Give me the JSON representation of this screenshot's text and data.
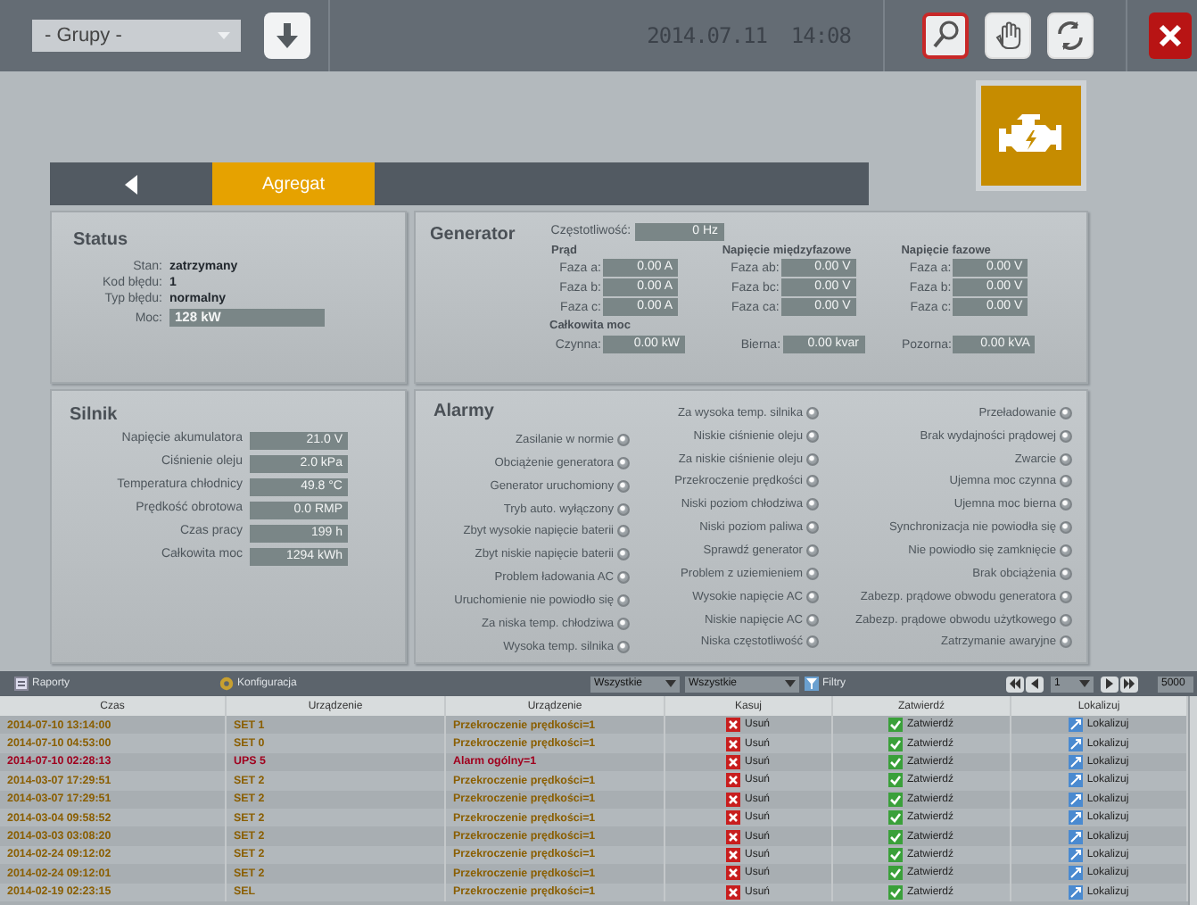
{
  "top_bar": {
    "group_select": {
      "value": "- Grupy -"
    },
    "datetime": "2014.07.11  14:08",
    "tools": [
      {
        "kind": "search",
        "selected": true
      },
      {
        "kind": "hand",
        "selected": false
      },
      {
        "kind": "refresh",
        "selected": false
      }
    ]
  },
  "nav": {
    "tabs": [
      {
        "label": "Agregat",
        "selected": true
      }
    ]
  },
  "status": {
    "title": "Status",
    "fields": [
      {
        "label": "Stan:",
        "value": "zatrzymany",
        "kind": "text"
      },
      {
        "label": "Kod błędu:",
        "value": "1",
        "kind": "text"
      },
      {
        "label": "Typ błędu:",
        "value": "normalny",
        "kind": "text"
      },
      {
        "label": "Moc:",
        "value": "128 kW",
        "kind": "box"
      }
    ]
  },
  "generator": {
    "title": "Generator",
    "frequency": {
      "label": "Częstotliwość:",
      "value": "0 Hz"
    },
    "groups": [
      {
        "title": "Prąd",
        "rows": [
          {
            "label": "Faza a:",
            "value": "0.00 A"
          },
          {
            "label": "Faza b:",
            "value": "0.00 A"
          },
          {
            "label": "Faza c:",
            "value": "0.00 A"
          }
        ]
      },
      {
        "title": "Napięcie międzyfazowe",
        "rows": [
          {
            "label": "Faza ab:",
            "value": "0.00 V"
          },
          {
            "label": "Faza bc:",
            "value": "0.00 V"
          },
          {
            "label": "Faza ca:",
            "value": "0.00 V"
          }
        ]
      },
      {
        "title": "Napięcie fazowe",
        "rows": [
          {
            "label": "Faza a:",
            "value": "0.00 V"
          },
          {
            "label": "Faza b:",
            "value": "0.00 V"
          },
          {
            "label": "Faza c:",
            "value": "0.00 V"
          }
        ]
      }
    ],
    "power_title": "Całkowita moc",
    "power": [
      {
        "label": "Czynna:",
        "value": "0.00 kW"
      },
      {
        "label": "Bierna:",
        "value": "0.00 kvar"
      },
      {
        "label": "Pozorna:",
        "value": "0.00 kVA"
      }
    ]
  },
  "silnik": {
    "title": "Silnik",
    "rows": [
      {
        "label": "Napięcie akumulatora",
        "value": "21.0 V"
      },
      {
        "label": "Ciśnienie oleju",
        "value": "2.0 kPa"
      },
      {
        "label": "Temperatura chłodnicy",
        "value": "49.8 °C"
      },
      {
        "label": "Prędkość obrotowa",
        "value": "0.0 RMP"
      },
      {
        "label": "Czas pracy",
        "value": "199 h"
      },
      {
        "label": "Całkowita moc",
        "value": "1294 kWh"
      }
    ]
  },
  "alarmy": {
    "title": "Alarmy",
    "columns": [
      [
        {
          "label": "Zasilanie w normie",
          "active": false
        },
        {
          "label": "Obciążenie generatora",
          "active": false
        },
        {
          "label": "Generator uruchomiony",
          "active": false
        },
        {
          "label": "Tryb auto. wyłączony",
          "active": false
        },
        {
          "label": "Zbyt wysokie napięcie baterii",
          "active": false
        },
        {
          "label": "Zbyt niskie napięcie baterii",
          "active": false
        },
        {
          "label": "Problem ładowania AC",
          "active": false
        },
        {
          "label": "Uruchomienie nie powiodło się",
          "active": false
        },
        {
          "label": "Za niska temp. chłodziwa",
          "active": false
        },
        {
          "label": "Wysoka temp. silnika",
          "active": false
        }
      ],
      [
        {
          "label": "Za wysoka temp. silnika",
          "active": false
        },
        {
          "label": "Niskie ciśnienie oleju",
          "active": false
        },
        {
          "label": "Za niskie ciśnienie oleju",
          "active": false
        },
        {
          "label": "Przekroczenie prędkości",
          "active": false
        },
        {
          "label": "Niski poziom chłodziwa",
          "active": false
        },
        {
          "label": "Niski poziom paliwa",
          "active": false
        },
        {
          "label": "Sprawdź generator",
          "active": false
        },
        {
          "label": "Problem z uziemieniem",
          "active": false
        },
        {
          "label": "Wysokie napięcie AC",
          "active": false
        },
        {
          "label": "Niskie napięcie AC",
          "active": false
        },
        {
          "label": "Niska częstotliwość",
          "active": false
        }
      ],
      [
        {
          "label": "Przeładowanie",
          "active": false
        },
        {
          "label": "Brak wydajności prądowej",
          "active": false
        },
        {
          "label": "Zwarcie",
          "active": false
        },
        {
          "label": "Ujemna moc czynna",
          "active": false
        },
        {
          "label": "Ujemna moc bierna",
          "active": false
        },
        {
          "label": "Synchronizacja nie powiodła się",
          "active": false
        },
        {
          "label": "Nie powiodło się zamknięcie",
          "active": false
        },
        {
          "label": "Brak obciążenia",
          "active": false
        },
        {
          "label": "Zabezp. prądowe obwodu generatora",
          "active": false
        },
        {
          "label": "Zabezp. prądowe obwodu użytkowego",
          "active": false
        },
        {
          "label": "Zatrzymanie awaryjne",
          "active": false
        }
      ]
    ]
  },
  "bottom_toolbar": {
    "reports": "Raporty",
    "config": "Konfiguracja",
    "filter_selects": [
      "Wszystkie",
      "Wszystkie"
    ],
    "filters": "Filtry",
    "page": "1",
    "page_size": "5000"
  },
  "table": {
    "columns": [
      "Czas",
      "Urządzenie",
      "Urządzenie",
      "Kasuj",
      "Zatwierdź",
      "Lokalizuj"
    ],
    "rows": [
      {
        "color": "#8a5e00",
        "cells": [
          "2014-07-10 13:14:00",
          "SET 1",
          "Przekroczenie prędkości=1"
        ],
        "actions": [
          "Usuń",
          "Zatwierdź",
          "Lokalizuj"
        ]
      },
      {
        "color": "#8a5e00",
        "cells": [
          "2014-07-10 04:53:00",
          "SET 0",
          "Przekroczenie prędkości=1"
        ],
        "actions": [
          "Usuń",
          "Zatwierdź",
          "Lokalizuj"
        ]
      },
      {
        "color": "#a0001e",
        "cells": [
          "2014-07-10 02:28:13",
          "UPS 5",
          "Alarm ogólny=1"
        ],
        "actions": [
          "Usuń",
          "Zatwierdź",
          "Lokalizuj"
        ]
      },
      {
        "color": "#8a5e00",
        "cells": [
          "2014-03-07 17:29:51",
          "SET 2",
          "Przekroczenie prędkości=1"
        ],
        "actions": [
          "Usuń",
          "Zatwierdź",
          "Lokalizuj"
        ]
      },
      {
        "color": "#8a5e00",
        "cells": [
          "2014-03-07 17:29:51",
          "SET 2",
          "Przekroczenie prędkości=1"
        ],
        "actions": [
          "Usuń",
          "Zatwierdź",
          "Lokalizuj"
        ]
      },
      {
        "color": "#8a5e00",
        "cells": [
          "2014-03-04 09:58:52",
          "SET 2",
          "Przekroczenie prędkości=1"
        ],
        "actions": [
          "Usuń",
          "Zatwierdź",
          "Lokalizuj"
        ]
      },
      {
        "color": "#8a5e00",
        "cells": [
          "2014-03-03 03:08:20",
          "SET 2",
          "Przekroczenie prędkości=1"
        ],
        "actions": [
          "Usuń",
          "Zatwierdź",
          "Lokalizuj"
        ]
      },
      {
        "color": "#8a5e00",
        "cells": [
          "2014-02-24 09:12:02",
          "SET 2",
          "Przekroczenie prędkości=1"
        ],
        "actions": [
          "Usuń",
          "Zatwierdź",
          "Lokalizuj"
        ]
      },
      {
        "color": "#8a5e00",
        "cells": [
          "2014-02-24 09:12:01",
          "SET 2",
          "Przekroczenie prędkości=1"
        ],
        "actions": [
          "Usuń",
          "Zatwierdź",
          "Lokalizuj"
        ]
      },
      {
        "color": "#8a5e00",
        "cells": [
          "2014-02-19 02:23:15",
          "SEL",
          "Przekroczenie prędkości=1"
        ],
        "actions": [
          "Usuń",
          "Zatwierdź",
          "Lokalizuj"
        ]
      }
    ]
  }
}
